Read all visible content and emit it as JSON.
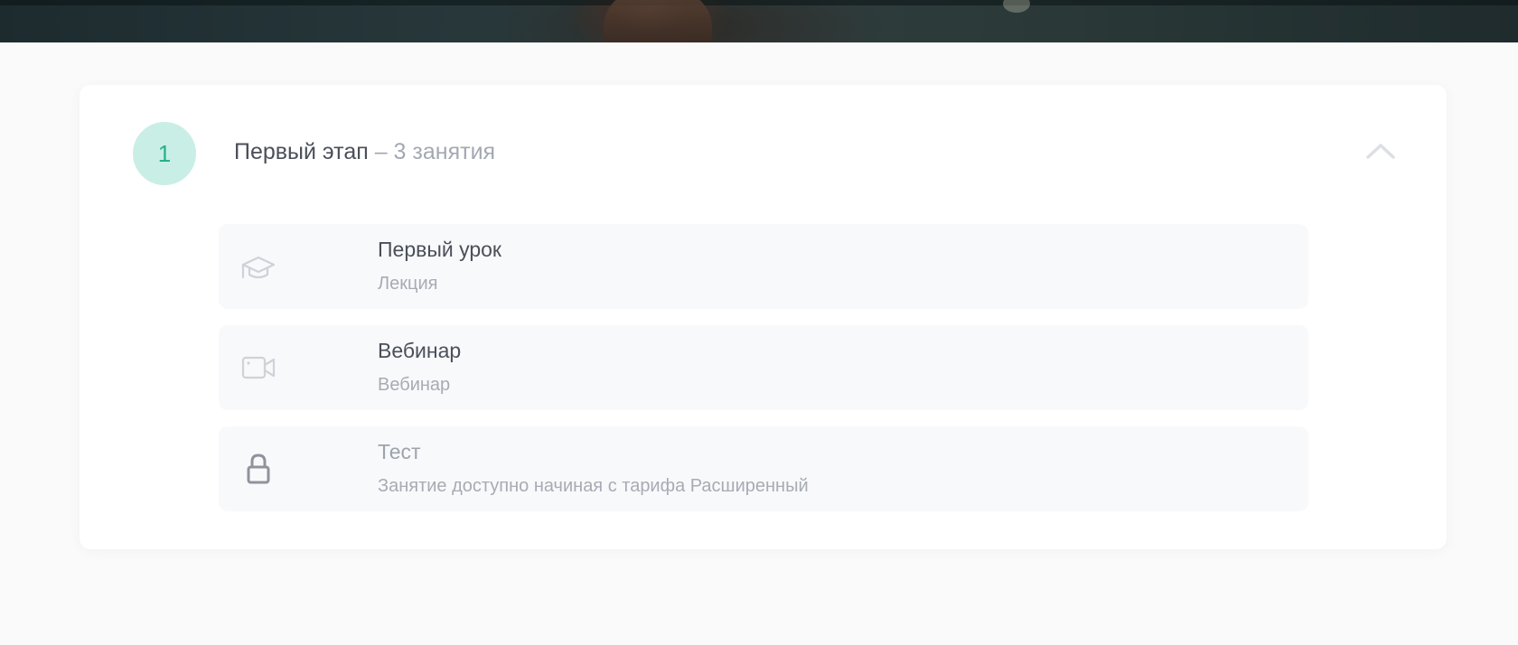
{
  "hero": {
    "icon": "hero-image"
  },
  "stage": {
    "number": "1",
    "title": "Первый этап",
    "count": " – 3 занятия",
    "collapse_icon": "chevron-up-icon"
  },
  "lessons": [
    {
      "title": "Первый урок",
      "subtitle": "Лекция",
      "icon": "graduation-cap-icon",
      "locked": false
    },
    {
      "title": "Вебинар",
      "subtitle": "Вебинар",
      "icon": "video-camera-icon",
      "locked": false
    },
    {
      "title": "Тест",
      "subtitle": "Занятие доступно начиная с тарифа Расширенный",
      "icon": "lock-icon",
      "locked": true
    }
  ],
  "colors": {
    "background": "#fafafa",
    "card": "#ffffff",
    "lesson_bg": "#f8f9fb",
    "badge_bg": "#c9eee6",
    "badge_text": "#26b28c",
    "title_text": "#4a4f59",
    "muted_text": "#a3a8b2"
  }
}
